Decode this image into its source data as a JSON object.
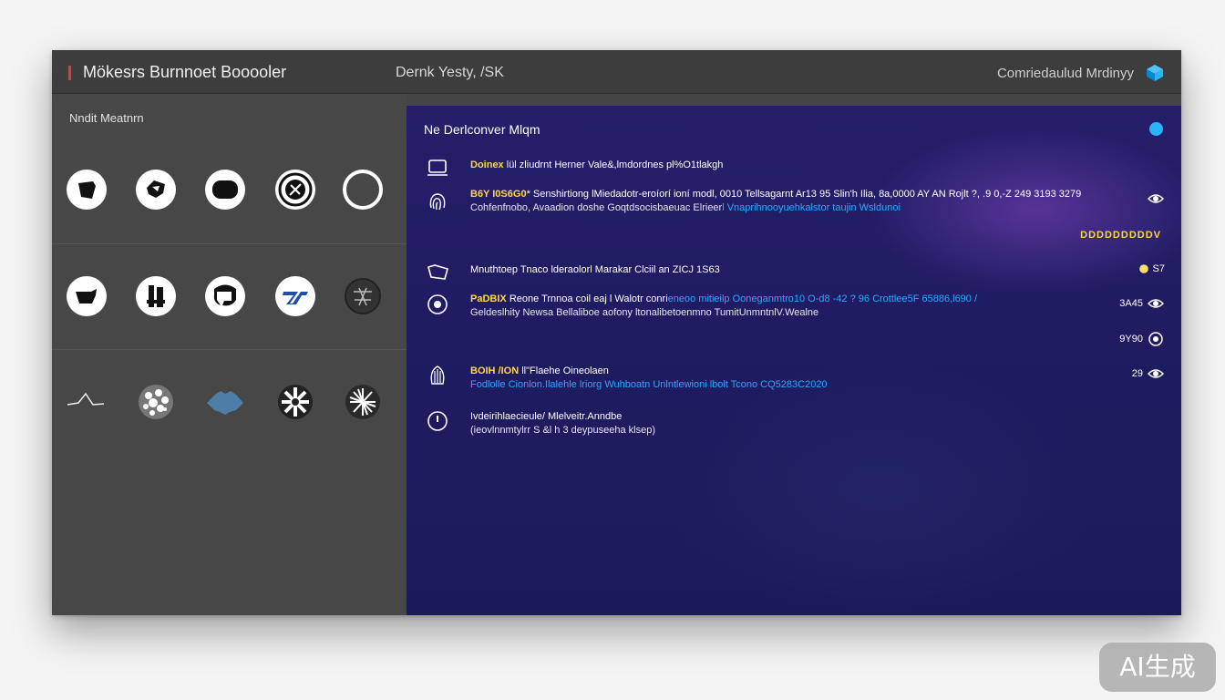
{
  "window": {
    "title": "Mökesrs Burnnoet Booooler",
    "center_title": "Dernk Yesty, /SK",
    "right_title": "Comriedaulud Mrdinyy"
  },
  "sidebar": {
    "title": "Nndit Meatnrn",
    "icons": [
      [
        "shirt-icon",
        "gem-icon",
        "frame-icon",
        "compass-icon",
        "ring-icon"
      ],
      [
        "teapot-icon",
        "tower-icon",
        "seven-icon",
        "brand-icon",
        "emblem-icon"
      ],
      [
        "wave-icon",
        "noise-icon",
        "cloud-icon",
        "star-icon",
        "burst-icon"
      ]
    ]
  },
  "panel": {
    "title": "Ne Derlconver Mlqm",
    "progress_text": "DDDDDDDDDV",
    "rows": [
      {
        "icon": "laptop-icon",
        "tag": "Doinex",
        "line1": "lül zliudrnt Herner Vale&,lmdordnes pl%O1tlakgh",
        "line2": "",
        "right": ""
      },
      {
        "icon": "fingerprint-icon",
        "tag": "B6Y I0S6G0",
        "line1": "* Senshirtiong lMiedadotr-eroíorí ioní modl, 0010  Tellsagarnt  Ar13 95 Slin'h Ilia, 8a,0000  AY AN",
        "line1_tail": "Rojlt  ?,  .9 0,-Z 249  3193  3279",
        "line2": "Cohfenfnobo, Avaadion doshe Goqtdsocisbaeuac Elrieer",
        "line2_blue": "l Vnaprihnooyuehkalstor taujin  Wsldunoi",
        "right": ""
      },
      {
        "icon": "folder-icon",
        "tag": "",
        "line1": "Mnuthtoep Tnaco  lderaolorl Marakar Clciil  an  ZICJ  1S63",
        "line2": "",
        "right": "S7"
      },
      {
        "icon": "target-icon",
        "tag": "PaDBIX",
        "line1": "Reone Trnnoa  coil eaj l Walotr   conri",
        "line1_blue": "eneoo mitieilp Ooneganmtro10   O-d8 -42 ? 96   Crottlee5F  65886,l690  /",
        "line2": "Geldeslhity Newsa Bellaliboe  aofony ltonalibetoenmno TumitUnmntnlV.Wealne",
        "right": "3A45"
      },
      {
        "icon": "",
        "tag": "",
        "line1": "",
        "line2": "",
        "right": "9Y90"
      },
      {
        "icon": "seashell-icon",
        "tag": "BOIH /ION",
        "line1": "ll\"Flaehe Oineolaen",
        "line2_blue": "Fodlolle Cionlon.Ilalehle lriorg  Wuhboatn Unlntlewioni lbolt Tcono  CQ5283C2020",
        "line2": "",
        "right": "29"
      },
      {
        "icon": "clock-icon",
        "tag": "",
        "line1": "Ivdeirihlaecieule/ Mlelveitr.Anndbe",
        "line2": "(ieovlnnmtylrr S &l h 3 deypuseeha klsep)",
        "right": ""
      }
    ]
  },
  "badge": {
    "label": "AI生成"
  }
}
